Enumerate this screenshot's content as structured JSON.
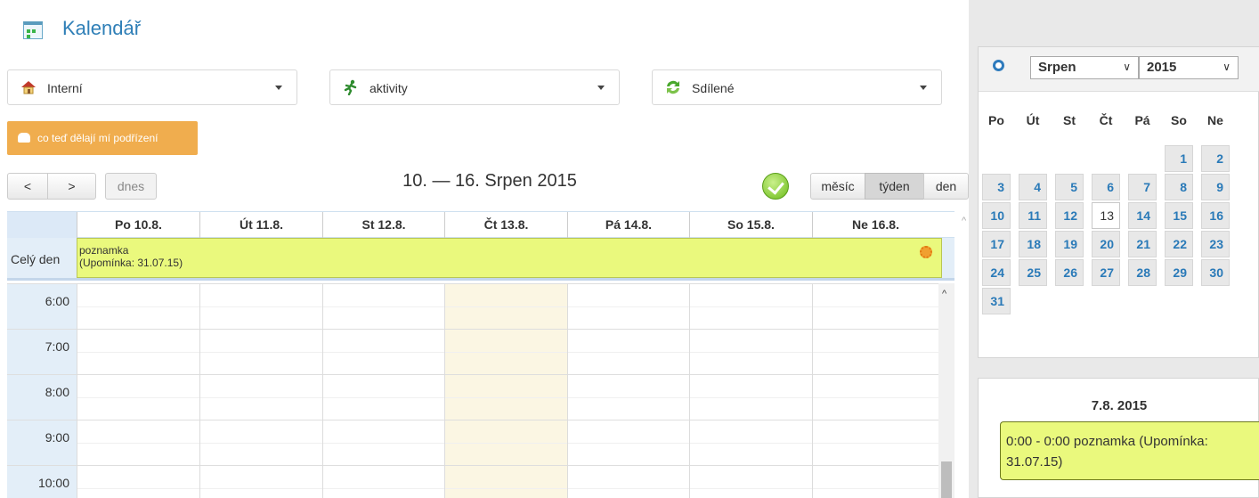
{
  "app": {
    "title": "Kalendář"
  },
  "filters": [
    {
      "label": "Interní",
      "icon": "house-icon"
    },
    {
      "label": "aktivity",
      "icon": "runner-icon"
    },
    {
      "label": "Sdílené",
      "icon": "share-icon"
    }
  ],
  "actions": {
    "subordinates_label": "co teď dělají mí podřízení"
  },
  "toolbar": {
    "prev_label": "<",
    "next_label": ">",
    "today_label": "dnes",
    "week_title": "10. — 16. Srpen 2015",
    "views": {
      "month": "měsíc",
      "week": "týden",
      "day": "den"
    },
    "active_view": "týden"
  },
  "week": {
    "days": [
      "Po 10.8.",
      "Út 11.8.",
      "St 12.8.",
      "Čt 13.8.",
      "Pá 14.8.",
      "So 15.8.",
      "Ne 16.8."
    ],
    "today_index": 3,
    "all_day_label": "Celý den",
    "all_day_event": {
      "line1": "poznamka",
      "line2": "(Upomínka: 31.07.15)"
    },
    "hours": [
      "6:00",
      "7:00",
      "8:00",
      "9:00",
      "10:00"
    ]
  },
  "mini_calendar": {
    "month": "Srpen",
    "year": "2015",
    "weekdays": [
      "Po",
      "Út",
      "St",
      "Čt",
      "Pá",
      "So",
      "Ne"
    ],
    "weeks": [
      [
        "",
        "",
        "",
        "",
        "",
        "1",
        "2"
      ],
      [
        "3",
        "4",
        "5",
        "6",
        "7",
        "8",
        "9"
      ],
      [
        "10",
        "11",
        "12",
        "13",
        "14",
        "15",
        "16"
      ],
      [
        "17",
        "18",
        "19",
        "20",
        "21",
        "22",
        "23"
      ],
      [
        "24",
        "25",
        "26",
        "27",
        "28",
        "29",
        "30"
      ],
      [
        "31",
        "",
        "",
        "",
        "",
        "",
        ""
      ]
    ],
    "today": "13"
  },
  "day_panel": {
    "date": "7.8. 2015",
    "event_line1": "0:00 - 0:00 poznamka (Upomínka:",
    "event_line2": "31.07.15)"
  },
  "colors": {
    "accent": "#2f7fb7",
    "event": "#eaf97d",
    "button_orange": "#f0ad4e",
    "today_column": "#fbf6e3"
  }
}
